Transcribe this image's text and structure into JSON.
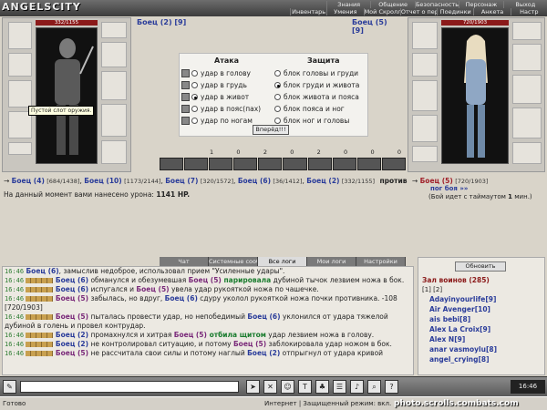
{
  "app": {
    "logo": "ANGELSCITY"
  },
  "menu": {
    "row1": [
      "Знания",
      "Общение",
      "Безопасность",
      "Персонаж",
      "Выход"
    ],
    "row2": [
      "Инвентарь",
      "Умения",
      "Мой Скролл",
      "Отчет о переводах",
      "Поединки",
      "Анкета",
      "Настр"
    ]
  },
  "left_char": {
    "hp": "332/1155",
    "tooltip": "Пустой слот оружия."
  },
  "right_char": {
    "hp": "720/1903"
  },
  "fight_head": {
    "left": "Боец (2) [9]",
    "right": "Боец (5) [9]"
  },
  "battle": {
    "attack_title": "Атака",
    "defense_title": "Защита",
    "attacks": [
      "удар в голову",
      "удар в грудь",
      "удар в живот",
      "удар в пояс(пах)",
      "удар по ногам"
    ],
    "defenses": [
      "блок головы и груди",
      "блок груди и живота",
      "блок живота и пояса",
      "блок пояса и ног",
      "блок ног и головы"
    ],
    "go_label": "Вперёд!!!",
    "stats": [
      "1",
      "0",
      "2",
      "0",
      "2",
      "0",
      "0",
      "0"
    ]
  },
  "teams": {
    "left": [
      {
        "name": "Боец (4)",
        "hp": "[684/1438]"
      },
      {
        "name": "Боец (10)",
        "hp": "[1173/2144]"
      },
      {
        "name": "Боец (7)",
        "hp": "[320/1572]"
      },
      {
        "name": "Боец (6)",
        "hp": "[36/1412]"
      },
      {
        "name": "Боец (2)",
        "hp": "[332/1155]"
      }
    ],
    "against": "против",
    "right": {
      "name": "Боец (5)",
      "hp": "[720/1903]"
    },
    "next": "пог боя »»",
    "damage_prefix": "На данный момент вами нанесено урона:",
    "damage_value": "1141 HP.",
    "timeout_prefix": "(Бой идет с таймаутом",
    "timeout_value": "1",
    "timeout_suffix": "мин.)"
  },
  "tabs": [
    "Чат",
    "Системные сообщения",
    "Все логи",
    "Мои логи",
    "Настройки"
  ],
  "log": [
    {
      "time": "16:46",
      "a": "Боец (6)",
      "text": ", замыслив недоброе, использовал прием \"Усиленные удары\"."
    },
    {
      "time": "16:46",
      "a": "Боец (6)",
      "text": " обманулся и обезумевшая ",
      "b": "Боец (5)",
      "hl": " парировала",
      "tail": " дубиной тычок лезвием ножа в бок."
    },
    {
      "time": "16:46",
      "a": "Боец (6)",
      "text": " испугался и ",
      "b": "Боец (5)",
      "tail": " увела удар рукояткой ножа по чашечке."
    },
    {
      "time": "16:46",
      "a": "Боец (5)",
      "text": " забылась, но вдруг, ",
      "b": "Боец (6)",
      "tail": " сдуру уколол рукояткой ножа почки противника. -108 [720/1903]"
    },
    {
      "time": "16:46",
      "a": "Боец (5)",
      "text": " пыталась провести удар, но непобедимый ",
      "b": "Боец (6)",
      "tail": " уклонился от удара тяжелой дубиной в голень и провел контрудар."
    },
    {
      "time": "16:46",
      "a": "Боец (2)",
      "text": " промахнулся и хитрая ",
      "b": "Боец (5)",
      "hl": " отбила щитом",
      "tail": " удар лезвием ножа в голову."
    },
    {
      "time": "16:46",
      "a": "Боец (2)",
      "text": " не контролировал ситуацию, и потому ",
      "b": "Боец (5)",
      "tail": " заблокировала удар ножом в бок."
    },
    {
      "time": "16:46",
      "a": "Боец (5)",
      "text": " не рассчитала свои силы и потому наглый ",
      "b": "Боец (2)",
      "tail": " отпрыгнул от удара кривой"
    }
  ],
  "users": {
    "refresh": "Обновить",
    "title": "Зал воинов (285)",
    "pages": "[1] [2]",
    "list": [
      "Adayinyourlife[9]",
      "Air Avenger[10]",
      "ais bebi[8]",
      "Alex La Croix[9]",
      "Alex N[9]",
      "anar vasmoylu[8]",
      "angel_crying[8]"
    ]
  },
  "toolbar": {
    "clock": "16:46"
  },
  "status": {
    "left": "Готово",
    "zone": "Интернет | Защищенный режим: вкл.",
    "watermark": "photo.scrolls.combats.com"
  },
  "colors": {
    "name_blue": "#2a3c9a",
    "enemy_red": "#a0202a",
    "time_green": "#2e7d32"
  }
}
